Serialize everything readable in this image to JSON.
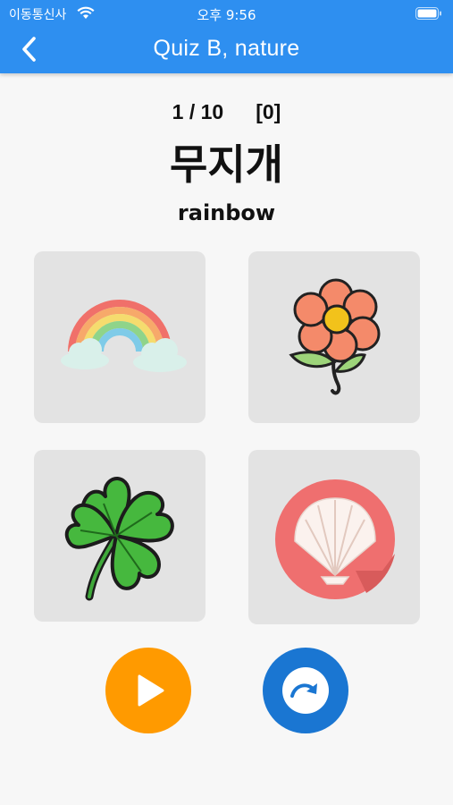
{
  "status_bar": {
    "carrier": "이동통신사",
    "time": "오후 9:56"
  },
  "header": {
    "title": "Quiz B, nature",
    "back_icon": "chevron-left-icon"
  },
  "quiz": {
    "progress": "1 / 10",
    "score": "[0]",
    "word": "무지개",
    "meaning": "rainbow"
  },
  "choices": [
    {
      "icon": "rainbow-icon"
    },
    {
      "icon": "flower-icon"
    },
    {
      "icon": "four-leaf-clover-icon"
    },
    {
      "icon": "seashell-icon"
    }
  ],
  "controls": {
    "play_icon": "play-icon",
    "next_icon": "redo-arrow-icon"
  },
  "colors": {
    "appbar": "#2e8ff0",
    "play_button": "#ff9a00",
    "next_button": "#1a76d2",
    "card_background": "#e3e3e3"
  }
}
